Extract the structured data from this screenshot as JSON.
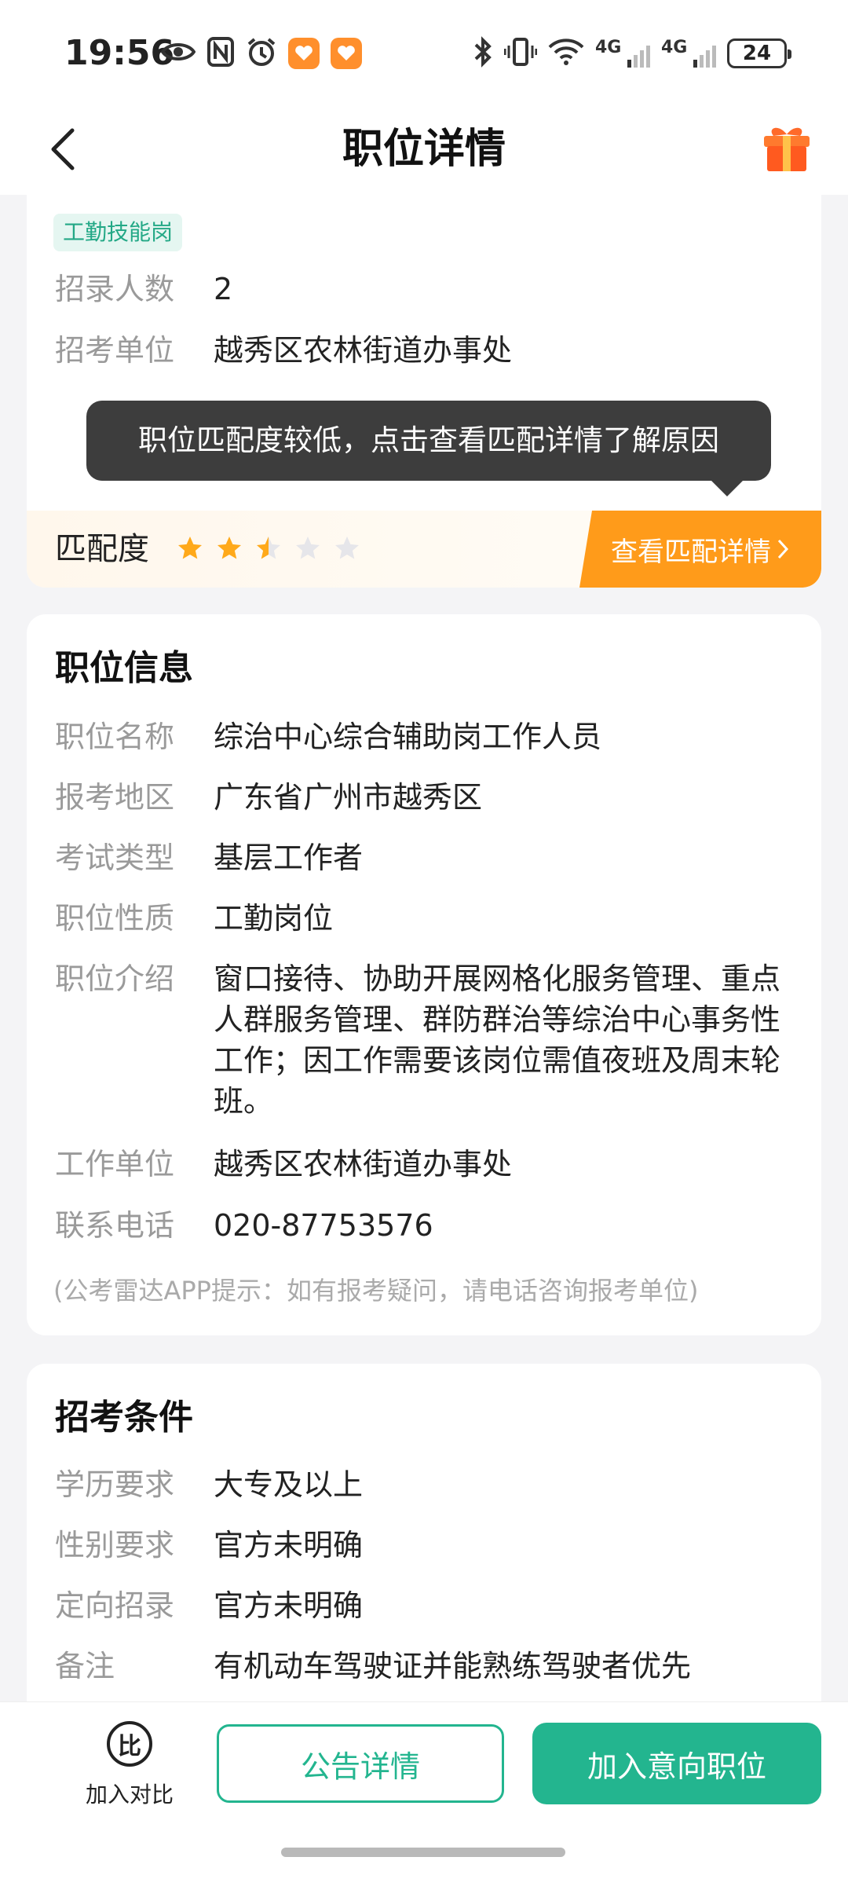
{
  "status_bar": {
    "time": "19:56",
    "battery": "24",
    "network_1": "4G",
    "network_2": "4G"
  },
  "header": {
    "title": "职位详情"
  },
  "top_card": {
    "tag": "工勤技能岗",
    "rows": [
      {
        "label": "招录人数",
        "value": "2"
      },
      {
        "label": "招考单位",
        "value": "越秀区农林街道办事处"
      }
    ]
  },
  "tooltip": {
    "text": "职位匹配度较低，点击查看匹配详情了解原因"
  },
  "match": {
    "label": "匹配度",
    "rating": 2.5,
    "max": 5,
    "button_label": "查看匹配详情"
  },
  "position_info": {
    "title": "职位信息",
    "rows": [
      {
        "label": "职位名称",
        "value": "综治中心综合辅助岗工作人员"
      },
      {
        "label": "报考地区",
        "value": "广东省广州市越秀区"
      },
      {
        "label": "考试类型",
        "value": "基层工作者"
      },
      {
        "label": "职位性质",
        "value": "工勤岗位"
      },
      {
        "label": "职位介绍",
        "value": "窗口接待、协助开展网格化服务管理、重点人群服务管理、群防群治等综治中心事务性工作；因工作需要该岗位需值夜班及周末轮班。"
      },
      {
        "label": "工作单位",
        "value": "越秀区农林街道办事处"
      },
      {
        "label": "联系电话",
        "value": "020-87753576"
      }
    ],
    "hint": "(公考雷达APP提示：如有报考疑问，请电话咨询报考单位)"
  },
  "conditions": {
    "title": "招考条件",
    "rows": [
      {
        "label": "学历要求",
        "value": "大专及以上"
      },
      {
        "label": "性别要求",
        "value": "官方未明确"
      },
      {
        "label": "定向招录",
        "value": "官方未明确"
      },
      {
        "label": "备注",
        "value": "有机动车驾驶证并能熟练驾驶者优先"
      }
    ]
  },
  "bottom_bar": {
    "compare_icon_text": "比",
    "compare_label": "加入对比",
    "notice_label": "公告详情",
    "intent_label": "加入意向职位"
  },
  "colors": {
    "accent_green": "#23b58f",
    "match_orange": "#ff9b1a",
    "star_gold": "#ffa91a",
    "star_empty": "#e6e6ea"
  }
}
